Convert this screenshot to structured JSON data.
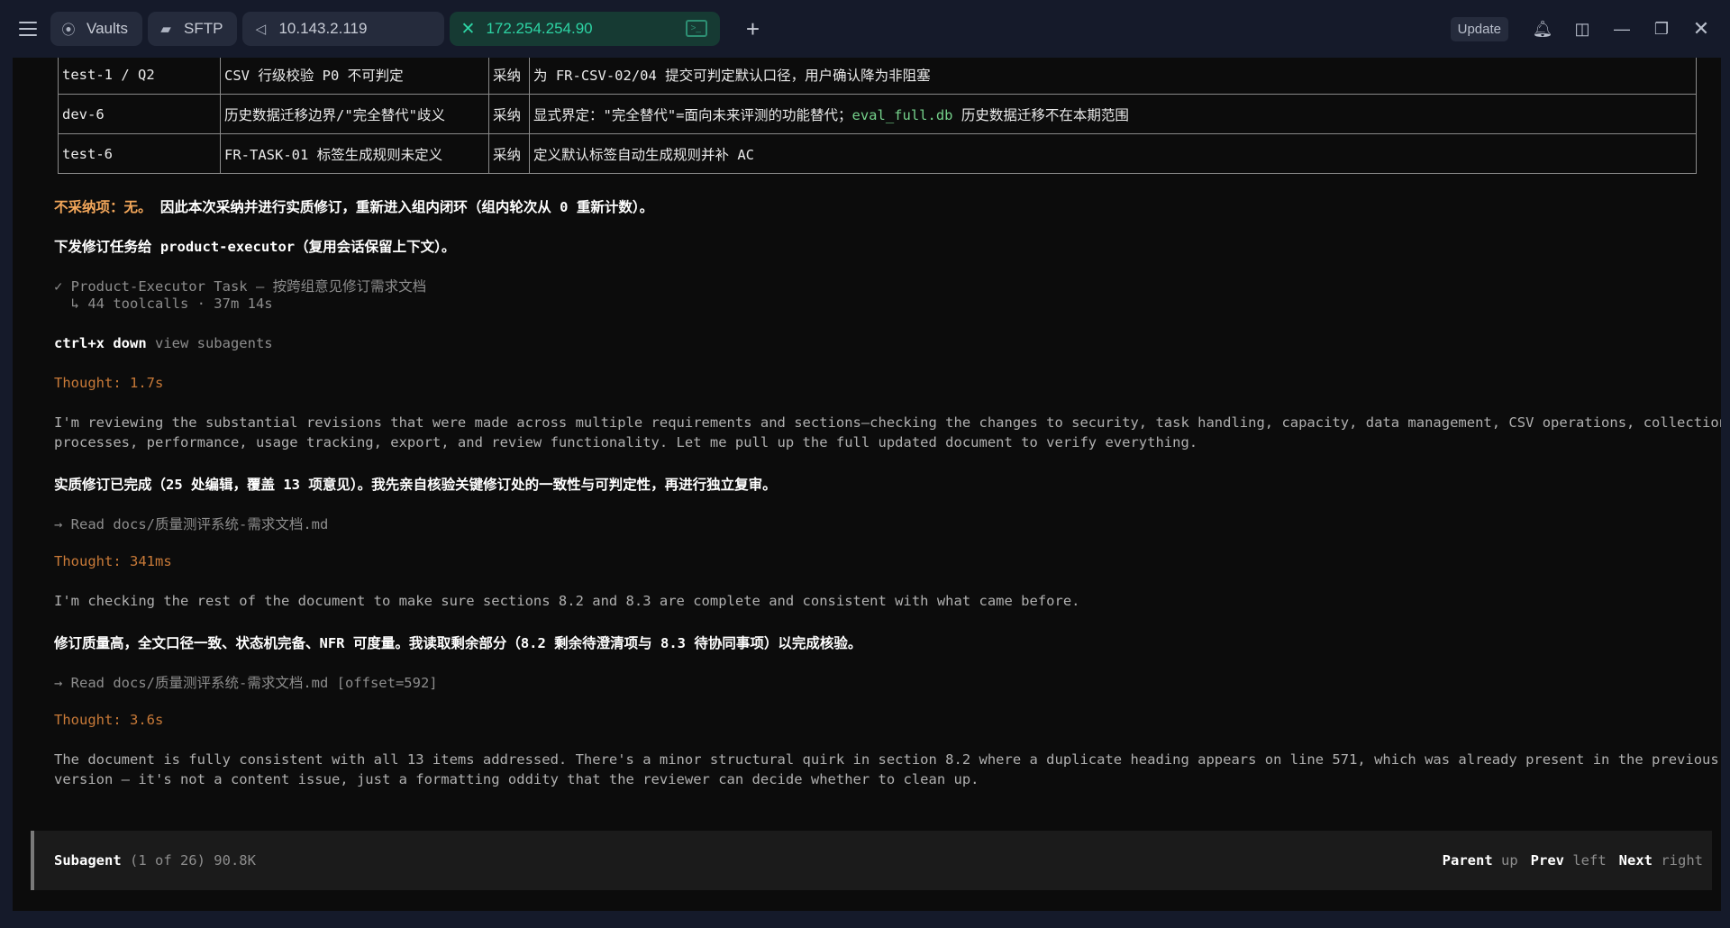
{
  "titlebar": {
    "tabs": [
      {
        "label": "Vaults",
        "icon": "vault-icon"
      },
      {
        "label": "SFTP",
        "icon": "folder-icon"
      },
      {
        "label": "10.143.2.119",
        "icon": "disconnected-icon"
      },
      {
        "label": "172.254.254.90",
        "icon": "close-icon",
        "active": true
      }
    ],
    "update_label": "Update"
  },
  "table": {
    "rows": [
      {
        "id": "test-1 / Q2",
        "issue": "CSV 行级校验 P0 不可判定",
        "decision": "采纳",
        "action": "为 FR-CSV-02/04 提交可判定默认口径，用户确认降为非阻塞"
      },
      {
        "id": "dev-6",
        "issue": "历史数据迁移边界/\"完全替代\"歧义",
        "decision": "采纳",
        "action_pre": "显式界定：\"完全替代\"=面向未来评测的功能替代；",
        "action_code": "eval_full.db",
        "action_post": " 历史数据迁移不在本期范围"
      },
      {
        "id": "test-6",
        "issue": "FR-TASK-01 标签生成规则未定义",
        "decision": "采纳",
        "action": "定义默认标签自动生成规则并补 AC"
      }
    ]
  },
  "log": {
    "not_adopted_label": "不采纳项：无。",
    "not_adopted_text": " 因此本次采纳并进行实质修订，重新进入组内闭环（组内轮次从 0 重新计数）。",
    "dispatch_text": "下发修订任务给 product-executor（复用会话保留上下文）。",
    "task_title": "✓ Product-Executor Task — 按跨组意见修订需求文档",
    "task_meta": "  ↳ 44 toolcalls · 37m 14s",
    "shortcut_key": "ctrl+x down",
    "shortcut_desc": " view subagents",
    "thought1": "Thought: 1.7s",
    "thought1_text_1": "I'm reviewing the substantial revisions that were made across multiple requirements and sections—checking the changes to security, task handling, capacity, data management, CSV operations, collection",
    "thought1_text_2": "processes, performance, usage tracking, export, and review functionality. Let me pull up the full updated document to verify everything.",
    "summary1": "实质修订已完成（25 处编辑，覆盖 13 项意见）。我先亲自核验关键修订处的一致性与可判定性，再进行独立复审。",
    "read1": "→ Read docs/质量测评系统-需求文档.md",
    "thought2": "Thought: 341ms",
    "thought2_text": "I'm checking the rest of the document to make sure sections 8.2 and 8.3 are complete and consistent with what came before.",
    "summary2": "修订质量高，全文口径一致、状态机完备、NFR 可度量。我读取剩余部分（8.2 剩余待澄清项与 8.3 待协同事项）以完成核验。",
    "read2": "→ Read docs/质量测评系统-需求文档.md [offset=592]",
    "thought3": "Thought: 3.6s",
    "thought3_text_1": "The document is fully consistent with all 13 items addressed. There's a minor structural quirk in section 8.2 where a duplicate heading appears on line 571, which was already present in the previous",
    "thought3_text_2": "version — it's not a content issue, just a formatting oddity that the reviewer can decide whether to clean up."
  },
  "footer": {
    "label": "Subagent",
    "info": " (1 of 26) 90.8K",
    "nav": [
      {
        "key": "Parent",
        "hint": " up"
      },
      {
        "key": "Prev",
        "hint": " left"
      },
      {
        "key": "Next",
        "hint": " right"
      }
    ]
  }
}
